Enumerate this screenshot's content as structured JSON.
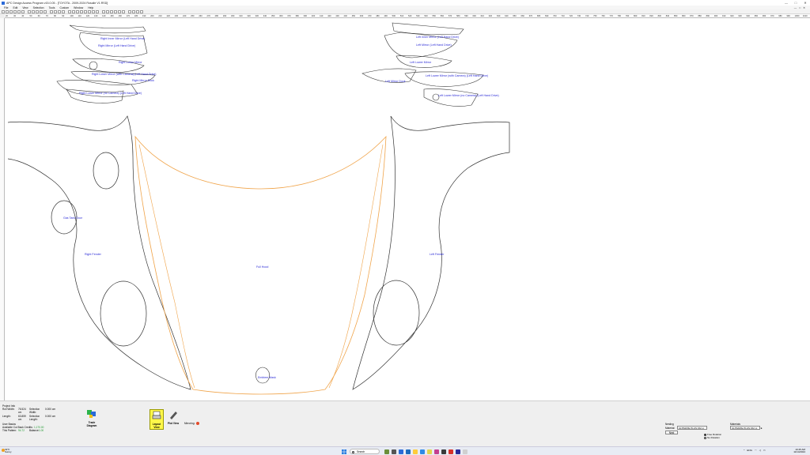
{
  "window": {
    "title": "APC Design Access Program v15.0.05 - [TOYOTA - 2009-2024 Rosalie V1.RSD]",
    "controls": [
      "—",
      "□",
      "✕"
    ]
  },
  "menubar": {
    "items": [
      "File",
      "Edit",
      "View",
      "Selection",
      "Tools",
      "Custom",
      "Window",
      "Help"
    ],
    "doc_controls": [
      "—",
      "□",
      "✕"
    ]
  },
  "rulers": {
    "top_ticks": [
      "20",
      "30",
      "40",
      "50",
      "60",
      "70",
      "80",
      "90",
      "100",
      "110",
      "120",
      "130",
      "140",
      "150",
      "160",
      "170",
      "180",
      "190",
      "200",
      "210",
      "220",
      "230",
      "240",
      "250",
      "260",
      "270",
      "280",
      "290",
      "300",
      "310",
      "320",
      "330",
      "340",
      "350",
      "360",
      "370",
      "380",
      "390",
      "400",
      "410",
      "420",
      "430",
      "440",
      "450",
      "460",
      "470",
      "480",
      "490",
      "500",
      "510",
      "520",
      "530",
      "540",
      "550",
      "560",
      "570",
      "580",
      "590",
      "600",
      "610",
      "620",
      "630",
      "640",
      "650",
      "660",
      "670",
      "680",
      "690",
      "700",
      "710",
      "720",
      "730",
      "740",
      "750",
      "760",
      "770",
      "780",
      "790",
      "800",
      "810",
      "820",
      "830",
      "840",
      "850",
      "860",
      "870",
      "880",
      "890",
      "900",
      "910",
      "920",
      "930",
      "940",
      "950",
      "960",
      "970",
      "980",
      "990",
      "1000",
      "1010"
    ]
  },
  "pieces": {
    "labels": [
      {
        "id": "right-inner-mirror",
        "text": "Right Inner Mirror (Left Hand Drive)"
      },
      {
        "id": "right-mirror",
        "text": "Right Mirror (Left Hand Drive)"
      },
      {
        "id": "right-lower-mirror",
        "text": "Right Lower Mirror"
      },
      {
        "id": "right-lower-mirror-camera",
        "text": "Right Lower Mirror (with Camera) (Left Hand Drive)"
      },
      {
        "id": "right-mirror-dock",
        "text": "Right Mirror Dock"
      },
      {
        "id": "right-lower-mirror-no-camera",
        "text": "Right Lower Mirror (no Camera) (Left Hand Drive)"
      },
      {
        "id": "left-inner-mirror",
        "text": "Left Inner Mirror (Left Hand Drive)"
      },
      {
        "id": "left-mirror",
        "text": "Left Mirror (Left Hand Drive)"
      },
      {
        "id": "left-lower-mirror",
        "text": "Left Lower Mirror"
      },
      {
        "id": "left-mirror-dock",
        "text": "Left Mirror Dock"
      },
      {
        "id": "left-lower-mirror-camera",
        "text": "Left Lower Mirror (with Camera) (Left Hand Drive)"
      },
      {
        "id": "left-lower-mirror-no-camera",
        "text": "Left Lower Mirror (no Camera) (Left Hand Drive)"
      },
      {
        "id": "gas-tank-door",
        "text": "Gas Tank Door"
      },
      {
        "id": "right-fender",
        "text": "Right Fender"
      },
      {
        "id": "full-hood",
        "text": "Full Hood"
      },
      {
        "id": "left-fender",
        "text": "Left Fender"
      },
      {
        "id": "emblem-mask",
        "text": "Emblem Mask"
      }
    ]
  },
  "bottom": {
    "project_info_title": "Project Info",
    "roll_width_label": "Roll Width:",
    "roll_width_value": "76.524 cm",
    "length_label": "Length:",
    "length_value": "63.859 cm",
    "selection_width_label": "Selection Width:",
    "selection_width_value": "0.000 cm",
    "selection_length_label": "Selection Length:",
    "selection_length_value": "0.000 cm",
    "user_basics_title": "User Basics",
    "available_label": "Available Cut Back Credits:",
    "available_value": "1,170.00",
    "this_pattern_label": "This Pattern:",
    "this_pattern_value": "94.72",
    "balance_label": "Balance:",
    "balance_value": "1.00",
    "trade_label": "Trade Diagram",
    "load_view_label": "Layout View",
    "plot_view_label": "Plot View",
    "mirror_label": "Mirroring:",
    "nesting_title": "Nesting",
    "nesting_material_label": "Material:",
    "nesting_material_value": "ULTIMATE PLUS 152 m",
    "nest_button": "Nest",
    "radio_free_rotation": "Free Rotation",
    "radio_no_rotation": "No Rotation",
    "material_title": "Materials",
    "material_value": "ULTIMATE PLUS 152 m"
  },
  "taskbar": {
    "weather_temp": "32°F",
    "weather_desc": "Sunny",
    "search_placeholder": "Search",
    "tray_lang": "ENG",
    "time": "10:45 AM",
    "date": "11/14/2024"
  },
  "colors": {
    "piece_outline": "#333333",
    "hood_outline": "#f0a44a",
    "label_blue": "#2a2ad6",
    "load_view_yellow": "#fff84a"
  }
}
